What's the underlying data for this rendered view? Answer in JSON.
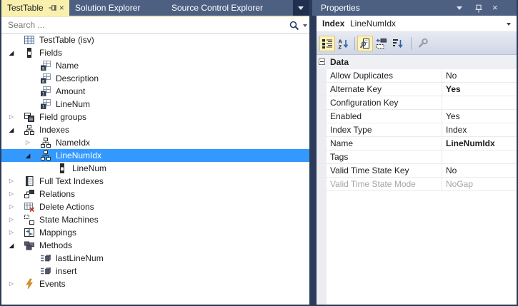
{
  "tabs": {
    "active": {
      "label": "TestTable"
    },
    "inactive": [
      {
        "label": "Solution Explorer"
      },
      {
        "label": "Source Control Explorer"
      }
    ]
  },
  "search": {
    "placeholder": "Search ..."
  },
  "tree": {
    "items": [
      {
        "label": "TestTable (isv)",
        "depth": 0,
        "icon": "table",
        "expander": "none",
        "selected": false
      },
      {
        "label": "Fields",
        "depth": 0,
        "icon": "fields",
        "expander": "expanded",
        "selected": false
      },
      {
        "label": "Name",
        "depth": 1,
        "icon": "field-string",
        "expander": "none",
        "selected": false
      },
      {
        "label": "Description",
        "depth": 1,
        "icon": "field-string",
        "expander": "none",
        "selected": false
      },
      {
        "label": "Amount",
        "depth": 1,
        "icon": "field-number",
        "expander": "none",
        "selected": false
      },
      {
        "label": "LineNum",
        "depth": 1,
        "icon": "field-number",
        "expander": "none",
        "selected": false
      },
      {
        "label": "Field groups",
        "depth": 0,
        "icon": "field-groups",
        "expander": "collapsed",
        "selected": false
      },
      {
        "label": "Indexes",
        "depth": 0,
        "icon": "index",
        "expander": "expanded",
        "selected": false
      },
      {
        "label": "NameIdx",
        "depth": 1,
        "icon": "index",
        "expander": "collapsed",
        "selected": false
      },
      {
        "label": "LineNumIdx",
        "depth": 1,
        "icon": "index",
        "expander": "expanded",
        "selected": true
      },
      {
        "label": "LineNum",
        "depth": 2,
        "icon": "field-plain",
        "expander": "none",
        "selected": false
      },
      {
        "label": "Full Text Indexes",
        "depth": 0,
        "icon": "fulltext",
        "expander": "collapsed",
        "selected": false
      },
      {
        "label": "Relations",
        "depth": 0,
        "icon": "relations",
        "expander": "collapsed",
        "selected": false
      },
      {
        "label": "Delete Actions",
        "depth": 0,
        "icon": "delete-actions",
        "expander": "collapsed",
        "selected": false
      },
      {
        "label": "State Machines",
        "depth": 0,
        "icon": "state-machines",
        "expander": "collapsed",
        "selected": false
      },
      {
        "label": "Mappings",
        "depth": 0,
        "icon": "mappings",
        "expander": "collapsed",
        "selected": false
      },
      {
        "label": "Methods",
        "depth": 0,
        "icon": "methods",
        "expander": "expanded",
        "selected": false
      },
      {
        "label": "lastLineNum",
        "depth": 1,
        "icon": "method",
        "expander": "none",
        "selected": false
      },
      {
        "label": "insert",
        "depth": 1,
        "icon": "method",
        "expander": "none",
        "selected": false
      },
      {
        "label": "Events",
        "depth": 0,
        "icon": "events",
        "expander": "collapsed",
        "selected": false
      }
    ]
  },
  "properties": {
    "title": "Properties",
    "selected_object": {
      "type": "Index",
      "name": "LineNumIdx"
    },
    "category": "Data",
    "rows": [
      {
        "label": "Allow Duplicates",
        "value": "No",
        "bold": false,
        "disabled": false
      },
      {
        "label": "Alternate Key",
        "value": "Yes",
        "bold": true,
        "disabled": false
      },
      {
        "label": "Configuration Key",
        "value": "",
        "bold": false,
        "disabled": false
      },
      {
        "label": "Enabled",
        "value": "Yes",
        "bold": false,
        "disabled": false
      },
      {
        "label": "Index Type",
        "value": "Index",
        "bold": false,
        "disabled": false
      },
      {
        "label": "Name",
        "value": "LineNumIdx",
        "bold": true,
        "disabled": false
      },
      {
        "label": "Tags",
        "value": "",
        "bold": false,
        "disabled": false
      },
      {
        "label": "Valid Time State Key",
        "value": "No",
        "bold": false,
        "disabled": false
      },
      {
        "label": "Valid Time State Mode",
        "value": "NoGap",
        "bold": false,
        "disabled": true
      }
    ]
  },
  "icons": {
    "expand-arrow-icon": "hollow right triangle",
    "collapse-arrow-icon": "filled down-right triangle",
    "search-icon": "magnifier",
    "pin-icon": "pushpin",
    "close-icon": "x",
    "events-icon": "orange lightning bolt"
  },
  "colors": {
    "selection": "#3399ff",
    "active_tab": "#faf0ae",
    "inactive_tab": "#4d6082",
    "titlebar": "#4d6082",
    "frame": "#2b3b59",
    "toolbar_selected": "#fdf3bf",
    "disabled_text": "#a5a5a5",
    "events_bolt": "#e2920f"
  }
}
